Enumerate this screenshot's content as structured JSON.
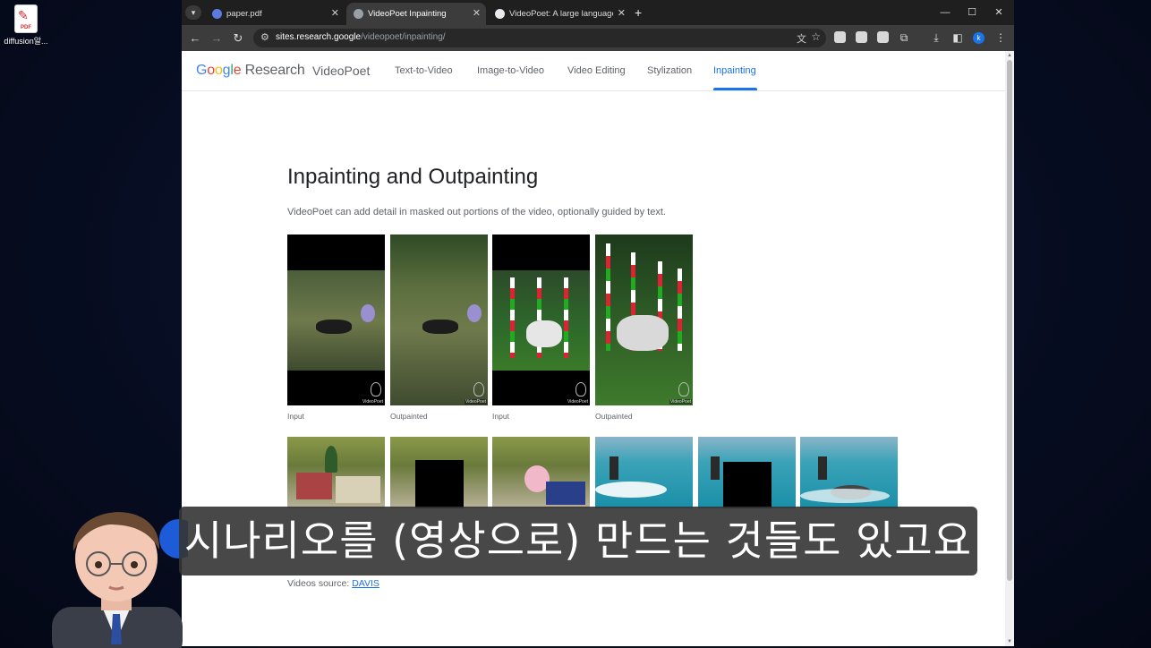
{
  "desktop": {
    "icon_label": "diffusion알...",
    "icon_badge": "PDF"
  },
  "tabs": [
    {
      "title": "paper.pdf",
      "active": false,
      "icon_color": "#5b7be0"
    },
    {
      "title": "VideoPoet Inpainting",
      "active": true,
      "icon_color": "#9aa0a6"
    },
    {
      "title": "VideoPoet: A large language m",
      "active": false,
      "icon_color": "#e8eaed"
    }
  ],
  "toolbar": {
    "url_host": "sites.research.google",
    "url_path": "/videopoet/inpainting/",
    "profile_letter": "k"
  },
  "site": {
    "logo_google": [
      "G",
      "o",
      "o",
      "g",
      "l",
      "e"
    ],
    "logo_research": "Research",
    "name": "VideoPoet",
    "nav": [
      "Text-to-Video",
      "Image-to-Video",
      "Video Editing",
      "Stylization",
      "Inpainting"
    ],
    "active_nav": "Inpainting"
  },
  "content": {
    "title": "Inpainting and Outpainting",
    "description": "VideoPoet can add detail in masked out portions of the video, optionally guided by text.",
    "row1_captions": [
      "Input",
      "Outpainted",
      "Input",
      "Outpainted"
    ],
    "watermark": "VideoPoet",
    "source_label": "Videos source: ",
    "source_link": "DAVIS"
  },
  "subtitle": "시나리오를 (영상으로) 만드는 것들도 있고요",
  "colors": {
    "accent": "#1a73e8",
    "tabbar": "#1f1f1f",
    "toolbar": "#3c3c3c"
  }
}
